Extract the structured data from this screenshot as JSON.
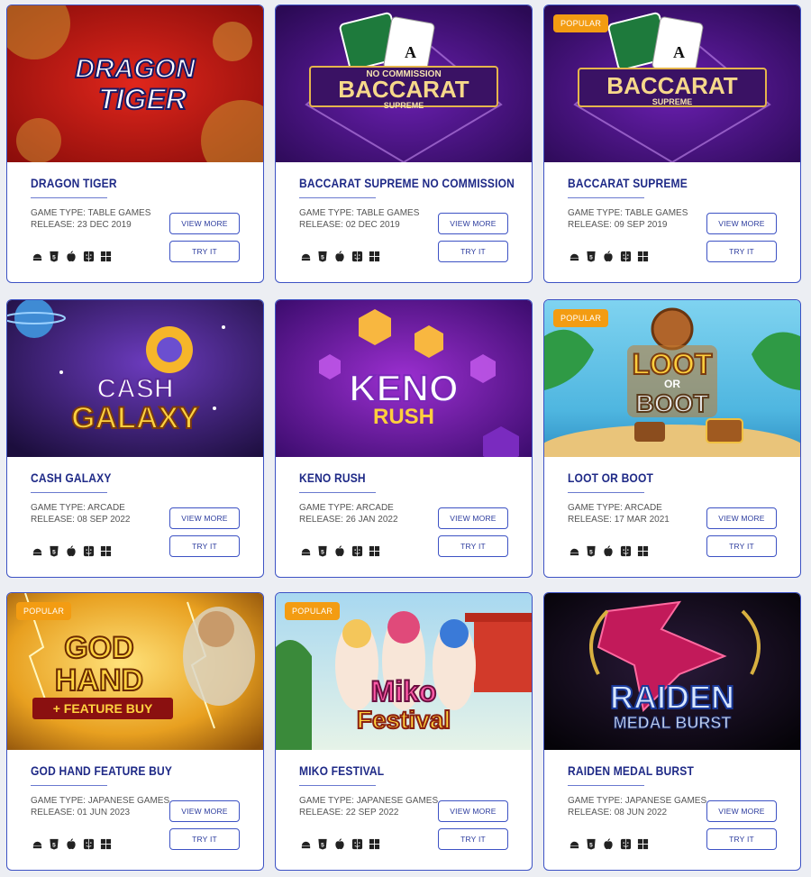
{
  "buttons": {
    "view_more": "VIEW MORE",
    "try_it": "TRY IT"
  },
  "labels": {
    "game_type_prefix": "GAME TYPE: ",
    "release_prefix": "RELEASE: ",
    "popular": "POPULAR"
  },
  "platform_icons": [
    "android-icon",
    "html5-icon",
    "apple-icon",
    "mac-finder-icon",
    "windows-icon"
  ],
  "colors": {
    "accent": "#3d52c4",
    "title": "#1f2a87",
    "badge": "#f39c12"
  },
  "games": [
    {
      "title": "DRAGON TIGER",
      "type": "TABLE GAMES",
      "release": "23 DEC 2019",
      "popular": false,
      "art": [
        "DRAGON",
        "TIGER"
      ]
    },
    {
      "title": "BACCARAT SUPREME NO COMMISSION",
      "type": "TABLE GAMES",
      "release": "02 DEC 2019",
      "popular": false,
      "art": [
        "NO COMMISSION",
        "BACCARAT",
        "SUPREME"
      ]
    },
    {
      "title": "BACCARAT SUPREME",
      "type": "TABLE GAMES",
      "release": "09 SEP 2019",
      "popular": true,
      "art": [
        "BACCARAT",
        "SUPREME"
      ]
    },
    {
      "title": "CASH GALAXY",
      "type": "ARCADE",
      "release": "08 SEP 2022",
      "popular": false,
      "art": [
        "CASH",
        "GALAXY"
      ]
    },
    {
      "title": "KENO RUSH",
      "type": "ARCADE",
      "release": "26 JAN 2022",
      "popular": false,
      "art": [
        "KENO",
        "RUSH"
      ]
    },
    {
      "title": "LOOT OR BOOT",
      "type": "ARCADE",
      "release": "17 MAR 2021",
      "popular": true,
      "art": [
        "LOOT",
        "OR",
        "BOOT"
      ]
    },
    {
      "title": "GOD HAND FEATURE BUY",
      "type": "JAPANESE GAMES",
      "release": "01 JUN 2023",
      "popular": true,
      "art": [
        "GOD",
        "HAND",
        "+ FEATURE BUY"
      ]
    },
    {
      "title": "MIKO FESTIVAL",
      "type": "JAPANESE GAMES",
      "release": "22 SEP 2022",
      "popular": true,
      "art": [
        "Miko",
        "Festival"
      ]
    },
    {
      "title": "RAIDEN MEDAL BURST",
      "type": "JAPANESE GAMES",
      "release": "08 JUN 2022",
      "popular": false,
      "art": [
        "RAIDEN",
        "MEDAL BURST"
      ]
    }
  ]
}
